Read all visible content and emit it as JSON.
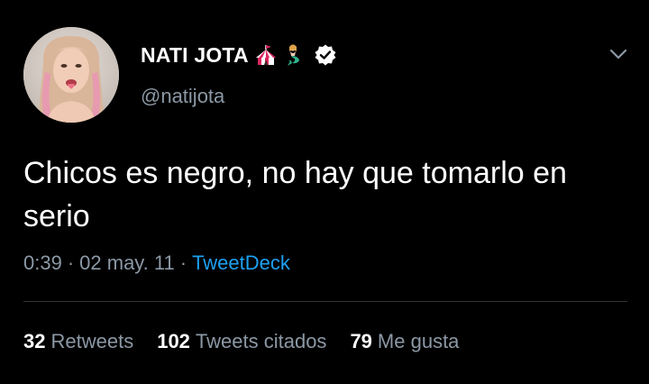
{
  "user": {
    "display_name": "NATI JOTA",
    "handle": "@natijota",
    "name_emojis": [
      "circus-tent-emoji",
      "mermaid-emoji"
    ],
    "verified": true
  },
  "tweet": {
    "text": "Chicos es negro, no hay que tomarlo en serio",
    "time": "0:39",
    "date": "02 may. 11",
    "separator": "·",
    "source": "TweetDeck"
  },
  "stats": {
    "retweets_count": "32",
    "retweets_label": "Retweets",
    "quotes_count": "102",
    "quotes_label": "Tweets citados",
    "likes_count": "79",
    "likes_label": "Me gusta"
  },
  "colors": {
    "background": "#000000",
    "secondary_text": "#8b98a5",
    "link": "#1da1f2",
    "divider": "#2f3336"
  }
}
